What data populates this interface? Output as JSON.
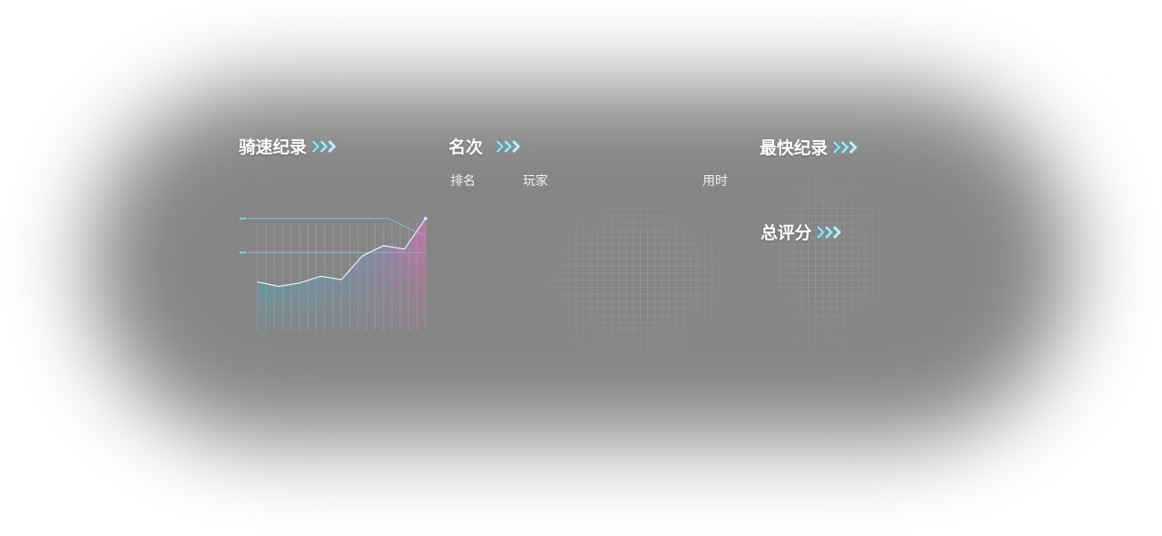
{
  "sections": {
    "speed_record": {
      "title": "骑速纪录",
      "icon": "chevrons-right-icon"
    },
    "rank": {
      "title": "名次",
      "icon": "chevrons-right-icon"
    },
    "fastest_record": {
      "title": "最快纪录",
      "icon": "chevrons-right-icon"
    },
    "total_score": {
      "title": "总评分",
      "icon": "chevrons-right-icon"
    }
  },
  "rank_table": {
    "headers": {
      "rank": "排名",
      "player": "玩家",
      "time": "用时"
    },
    "rows": []
  },
  "colors": {
    "accent": "#7fd3e6",
    "accent_deep": "#38b9d6",
    "highlight": "#d970b3",
    "background": "#858585",
    "text": "#ffffff"
  },
  "chart_data": {
    "type": "line",
    "title": "",
    "xlabel": "",
    "ylabel": "",
    "x": [
      1,
      2,
      3,
      4,
      5,
      6,
      7,
      8,
      9,
      10
    ],
    "series": [
      {
        "values": [
          1.8,
          1.3,
          1.4,
          1.6,
          1.5,
          2.2,
          2.5,
          2.4,
          3.3
        ]
      }
    ],
    "reference_lines": [
      3.3,
      2.3
    ],
    "ylim": [
      0,
      4
    ],
    "grid": true,
    "legend": "none"
  }
}
